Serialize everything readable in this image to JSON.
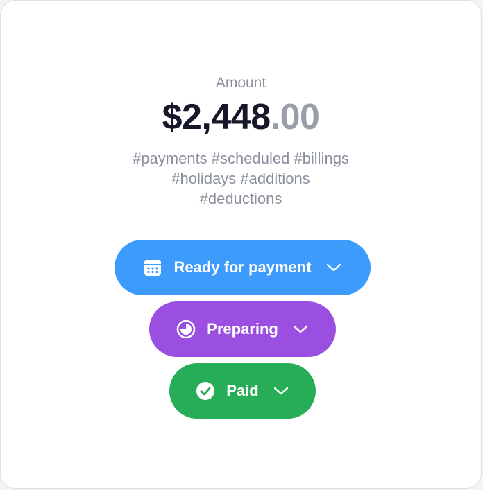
{
  "amount": {
    "label": "Amount",
    "whole": "$2,448",
    "cents": ".00"
  },
  "tags": [
    "#payments #scheduled #billings",
    "#holidays #additions",
    "#deductions"
  ],
  "statuses": [
    {
      "label": "Ready for payment",
      "icon": "calendar-icon",
      "color": "#3d9bfb"
    },
    {
      "label": "Preparing",
      "icon": "pie-progress-icon",
      "color": "#9b4fe0"
    },
    {
      "label": "Paid",
      "icon": "check-circle-icon",
      "color": "#27ad57"
    }
  ],
  "colors": {
    "text_primary": "#16182a",
    "text_muted": "#8a8f9c",
    "card_background": "#ffffff"
  }
}
